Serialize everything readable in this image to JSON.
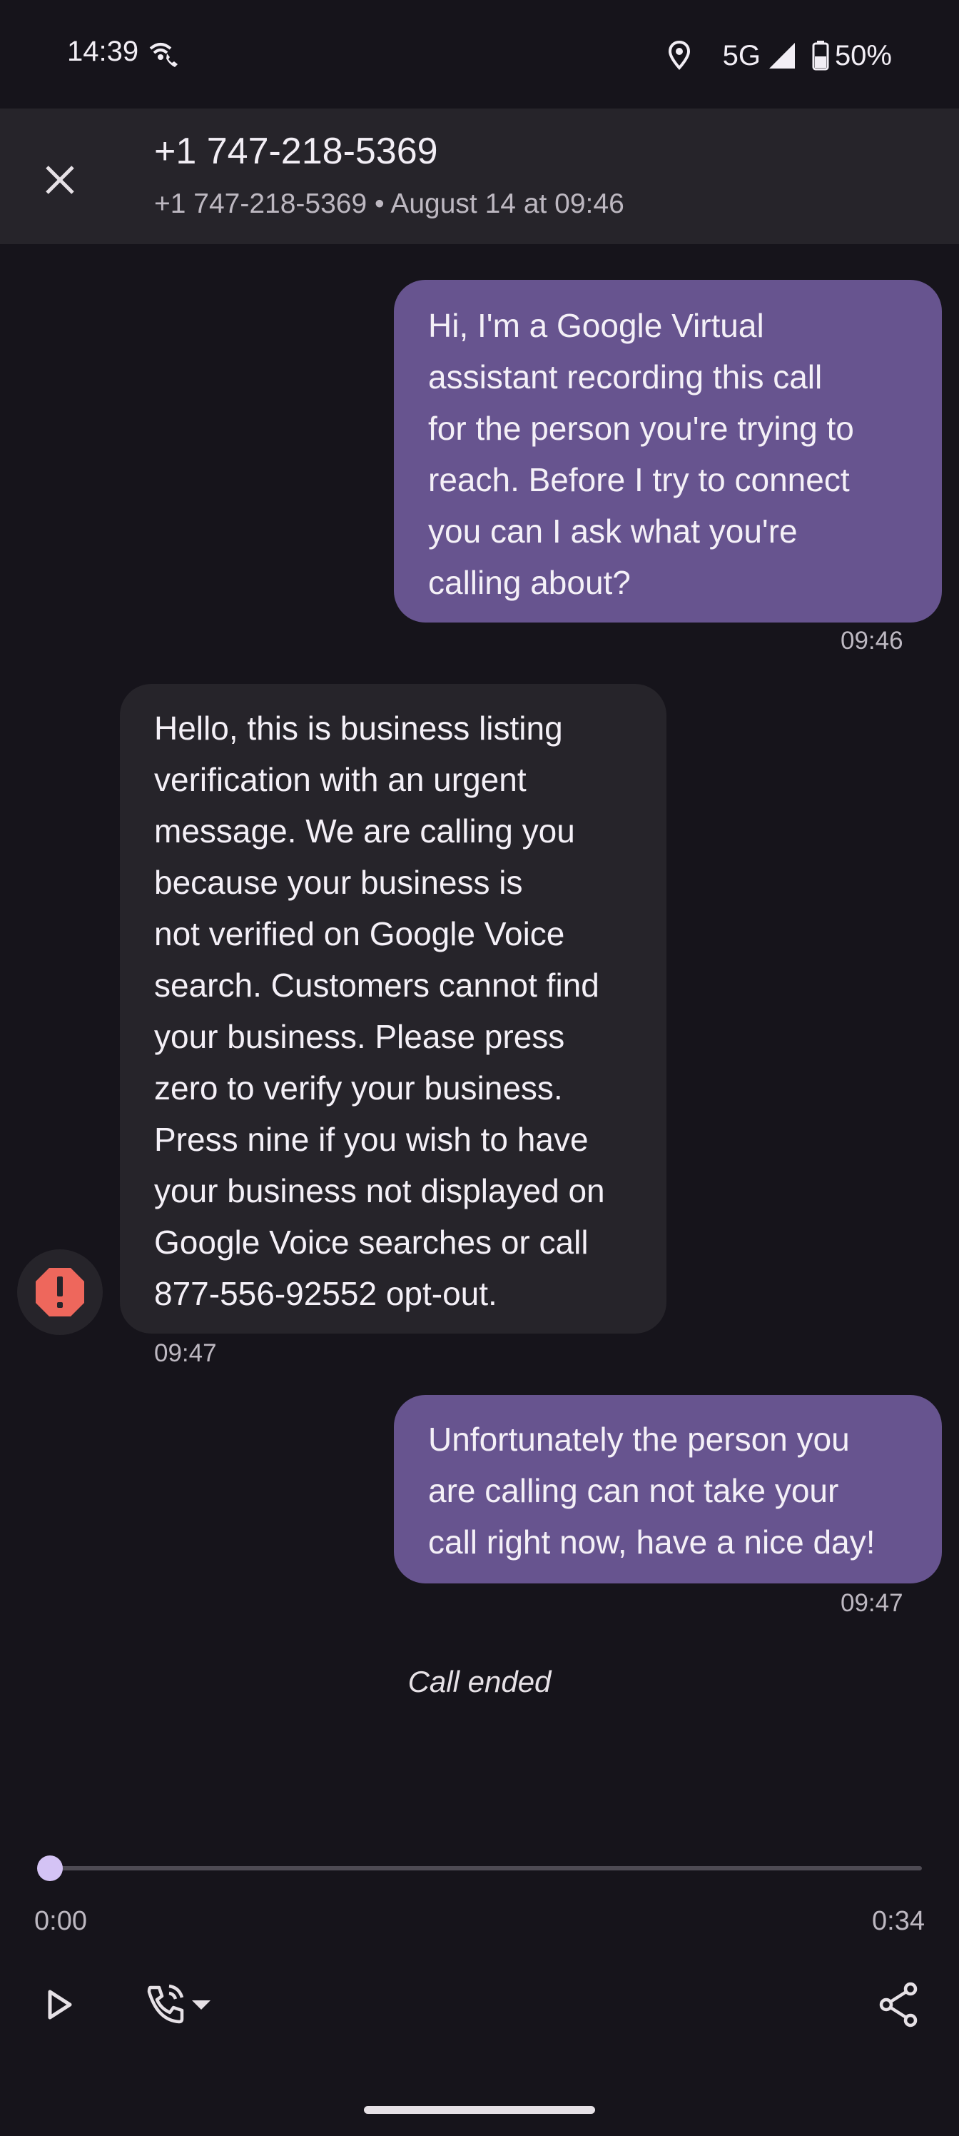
{
  "status_bar": {
    "time": "14:39",
    "network": "5G",
    "battery": "50%",
    "icons": [
      "wifi-calling-icon",
      "location-icon",
      "signal-icon",
      "battery-icon"
    ]
  },
  "header": {
    "title": "+1 747-218-5369",
    "subtitle": "+1 747-218-5369 • August 14 at 09:46",
    "close_icon": "close-icon"
  },
  "messages": [
    {
      "direction": "outgoing",
      "lines": [
        "Hi, I'm a Google Virtual",
        "assistant recording this call",
        "for the person you're trying to",
        "reach. Before I try to connect",
        "you can I ask what you're",
        "calling about?"
      ],
      "time": "09:46"
    },
    {
      "direction": "incoming",
      "lines": [
        "Hello, this is business listing",
        "verification with an urgent",
        "message. We are calling you",
        "because your business is",
        "not verified on Google Voice",
        "search. Customers cannot find",
        "your business. Please press",
        "zero to verify your business.",
        "Press nine if you wish to have",
        "your business not displayed on",
        "Google Voice searches or call",
        "877-556-92552 opt-out."
      ],
      "time": "09:47",
      "badge_icon": "spam-warning-icon"
    },
    {
      "direction": "outgoing",
      "lines": [
        "Unfortunately the person you",
        "are calling can not take your",
        "call right now, have a nice day!"
      ],
      "time": "09:47"
    }
  ],
  "call_status": "Call ended",
  "player": {
    "current_time": "0:00",
    "total_time": "0:34",
    "progress": 0,
    "controls": [
      "play-icon",
      "phone-audio-output-icon",
      "share-icon"
    ]
  },
  "colors": {
    "background": "#16141b",
    "header": "#26242a",
    "outgoing_bubble": "#67548f",
    "incoming_bubble": "#26242a",
    "spam_red": "#ee675c",
    "progress_knob": "#d4c3f5"
  }
}
